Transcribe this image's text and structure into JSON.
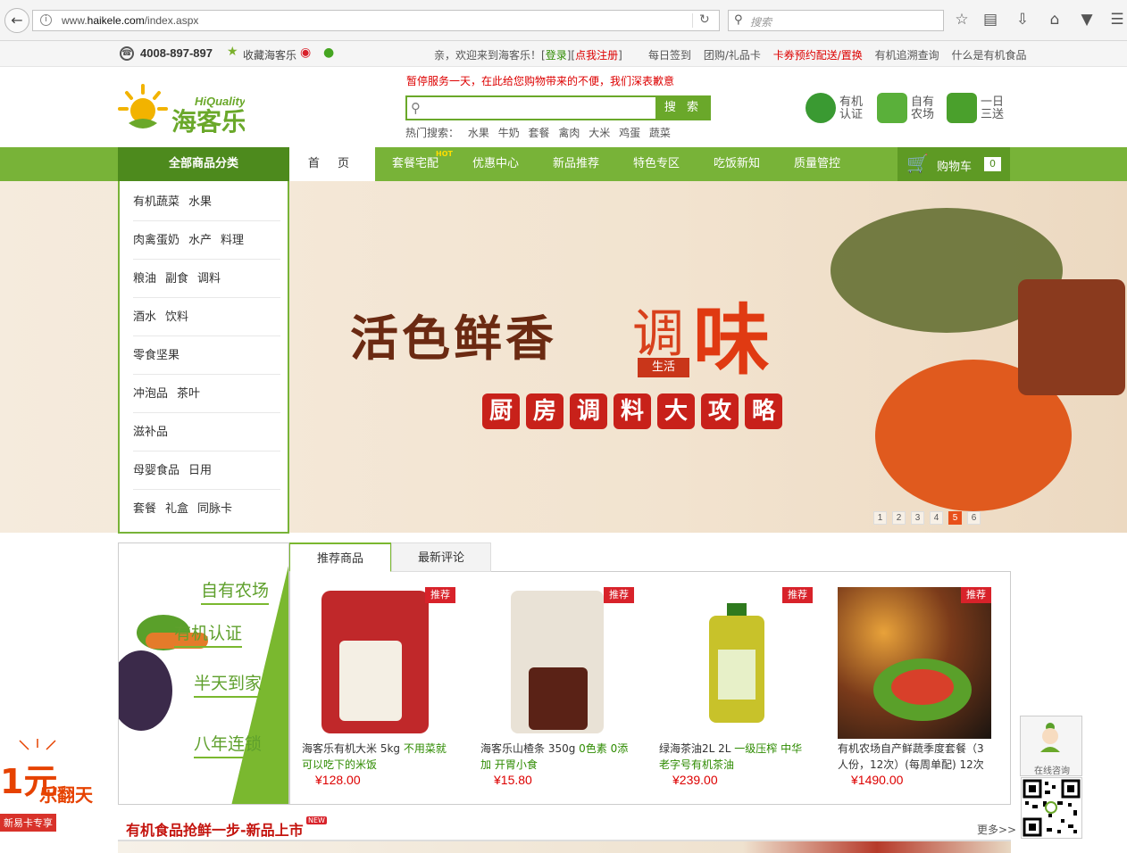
{
  "browser": {
    "url_prefix": "www.",
    "url_domain": "haikele.com",
    "url_path": "/index.aspx",
    "search_placeholder": "搜索"
  },
  "topbar": {
    "phone": "4008-897-897",
    "favorite": "收藏海客乐",
    "welcome_prefix": "亲，欢迎来到海客乐！[",
    "login": "登录",
    "mid": "][",
    "register": "点我注册",
    "welcome_suffix": "]",
    "links": [
      "每日签到",
      "团购/礼品卡",
      "卡券预约配送/置换",
      "有机追溯查询",
      "什么是有机食品"
    ]
  },
  "header": {
    "logo_small": "HiQuality",
    "logo_main": "海客乐",
    "notice": "暂停服务一天，在此给您购物带来的不便，我们深表歉意",
    "search_button": "搜 索",
    "hot_label": "热门搜索：",
    "hot_terms": [
      "水果",
      "牛奶",
      "套餐",
      "禽肉",
      "大米",
      "鸡蛋",
      "蔬菜"
    ],
    "badges": [
      {
        "label": "有机认证",
        "color": "#3a9a32"
      },
      {
        "label": "自有农场",
        "color": "#5ab03a"
      },
      {
        "label": "一日三送",
        "color": "#4aa02c"
      }
    ]
  },
  "nav": {
    "all_categories": "全部商品分类",
    "home": "首 页",
    "items": [
      "套餐宅配",
      "优惠中心",
      "新品推荐",
      "特色专区",
      "吃饭新知",
      "质量管控"
    ],
    "hot_tag": "HOT",
    "cart_label": "购物车",
    "cart_count": "0"
  },
  "categories": [
    [
      "有机蔬菜",
      "水果"
    ],
    [
      "肉禽蛋奶",
      "水产",
      "料理"
    ],
    [
      "粮油",
      "副食",
      "调料"
    ],
    [
      "酒水",
      "饮料"
    ],
    [
      "零食坚果"
    ],
    [
      "冲泡品",
      "茶叶"
    ],
    [
      "滋补品"
    ],
    [
      "母婴食品",
      "日用"
    ],
    [
      "套餐",
      "礼盒",
      "同脉卡"
    ]
  ],
  "banner": {
    "title": "活色鲜香",
    "tiao": "调",
    "wei": "味",
    "life": "生活",
    "sub": [
      "厨",
      "房",
      "调",
      "料",
      "大",
      "攻",
      "略"
    ],
    "pages": [
      "1",
      "2",
      "3",
      "4",
      "5",
      "6"
    ],
    "active_page": "5"
  },
  "promo": {
    "lines": [
      "自有农场",
      "有机认证",
      "半天到家",
      "八年连锁"
    ]
  },
  "tabs": [
    "推荐商品",
    "最新评论"
  ],
  "products": [
    {
      "tag": "推荐",
      "name": "海客乐有机大米 5kg ",
      "highlight": "不用菜就可以吃下的米饭",
      "price": "¥128.00",
      "color": "#c0282a"
    },
    {
      "tag": "推荐",
      "name": "海客乐山楂条 350g ",
      "highlight": "0色素 0添加 开胃小食",
      "price": "¥15.80",
      "color": "#e9e2d6"
    },
    {
      "tag": "推荐",
      "name": "绿海茶油2L 2L ",
      "highlight": "一级压榨 中华老字号有机茶油",
      "price": "¥239.00",
      "color": "#c8c22a"
    },
    {
      "tag": "推荐",
      "name": "有机农场自产鲜蔬季度套餐（3人份，12次）(每周单配) 12次",
      "highlight": "",
      "price": "¥1490.00",
      "color": "#7a3a1a"
    }
  ],
  "consult": {
    "label": "在线咨询"
  },
  "festival": {
    "big": "1元",
    "line": "新易卡专享",
    "side": "乐翻天"
  },
  "section": {
    "title": "有机食品抢鲜一步-新品上市",
    "new_tag": "NEW",
    "more": "更多>>"
  }
}
